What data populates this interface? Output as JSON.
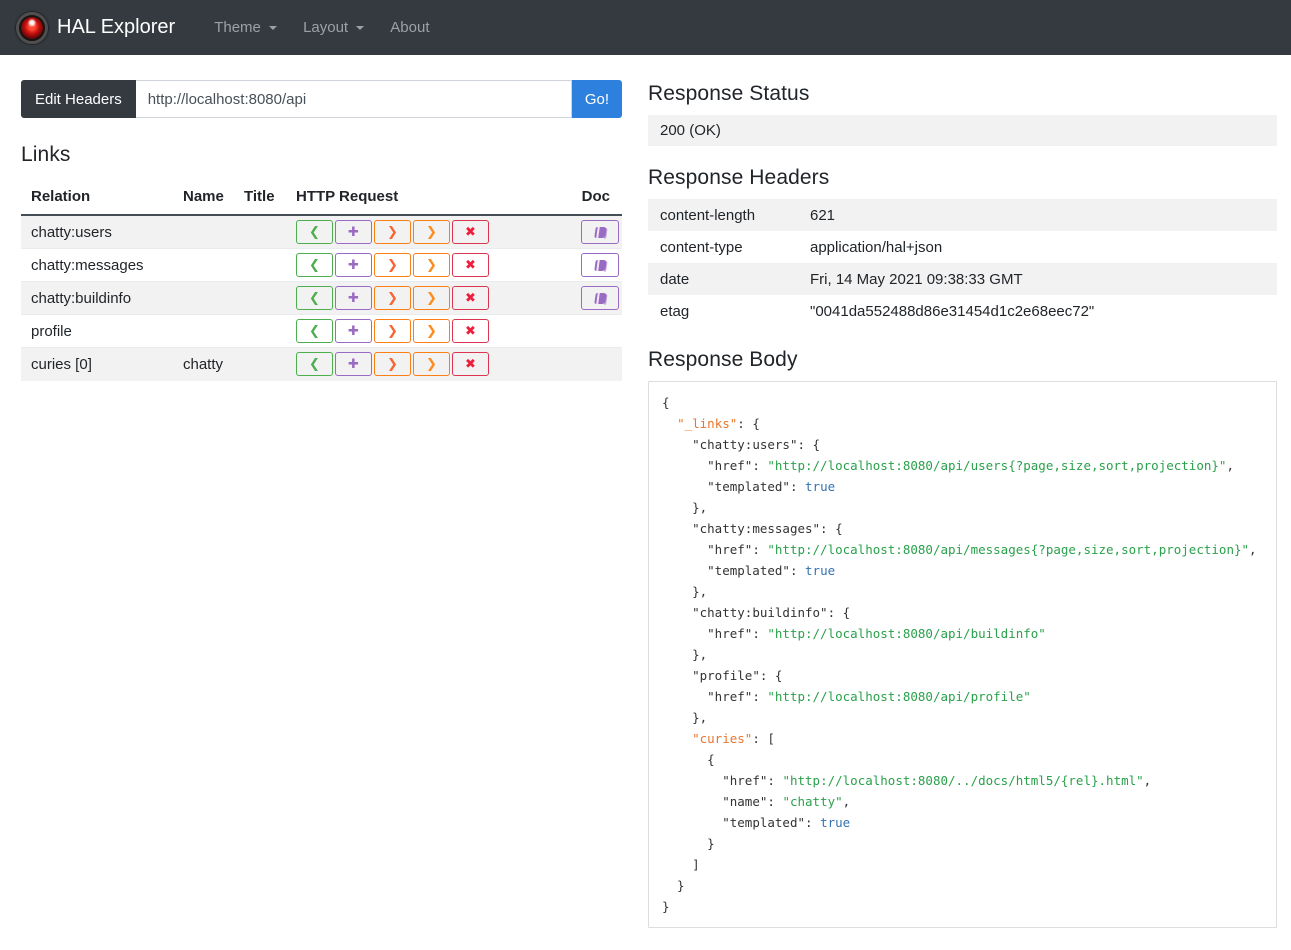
{
  "colors": {
    "navbar_bg": "#343a40",
    "brand_text": "#ffffff",
    "nav_link": "#9ba1a6",
    "primary_button": "#2e80de",
    "dark_button": "#343a40",
    "heading_text": "#212529",
    "stripe_bg": "#f2f2f2",
    "doc_color": "#9b6bc3",
    "json_punct": "#333333",
    "json_key": "#333333",
    "json_okey": "#e8762d",
    "json_string": "#2aa14b",
    "json_literal": "#3572b0"
  },
  "navbar": {
    "brand": "HAL Explorer",
    "logo": "hal-9000-eye",
    "menu": [
      {
        "id": "theme",
        "label": "Theme",
        "caret": true
      },
      {
        "id": "layout",
        "label": "Layout",
        "caret": true
      },
      {
        "id": "about",
        "label": "About",
        "caret": false
      }
    ]
  },
  "request_bar": {
    "edit_headers_label": "Edit Headers",
    "url_value": "http://localhost:8080/api",
    "go_label": "Go!"
  },
  "links_section": {
    "title": "Links",
    "columns": [
      "Relation",
      "Name",
      "Title",
      "HTTP Request",
      "Doc"
    ],
    "http_buttons": [
      {
        "id": "get",
        "glyph": "❮",
        "border": "#4cae4c",
        "color": "#4cae4c"
      },
      {
        "id": "post",
        "glyph": "✚",
        "border": "#9b6bc3",
        "color": "#9b6bc3"
      },
      {
        "id": "put",
        "glyph": "❯",
        "border": "#fd7e14",
        "color": "#fa6432"
      },
      {
        "id": "patch",
        "glyph": "❯",
        "border": "#fd7e14",
        "color": "#fd8c1e"
      },
      {
        "id": "delete",
        "glyph": "✖",
        "border": "#dc3552",
        "color": "#ef1c3c"
      }
    ],
    "rows": [
      {
        "relation": "chatty:users",
        "name": "",
        "title": "",
        "doc": true
      },
      {
        "relation": "chatty:messages",
        "name": "",
        "title": "",
        "doc": true
      },
      {
        "relation": "chatty:buildinfo",
        "name": "",
        "title": "",
        "doc": true
      },
      {
        "relation": "profile",
        "name": "",
        "title": "",
        "doc": false
      },
      {
        "relation": "curies [0]",
        "name": "chatty",
        "title": "",
        "doc": false
      }
    ]
  },
  "response_status": {
    "title": "Response Status",
    "value": "200 (OK)"
  },
  "response_headers": {
    "title": "Response Headers",
    "rows": [
      {
        "key": "content-length",
        "value": "621"
      },
      {
        "key": "content-type",
        "value": "application/hal+json"
      },
      {
        "key": "date",
        "value": "Fri, 14 May 2021 09:38:33 GMT"
      },
      {
        "key": "etag",
        "value": "\"0041da552488d86e31454d1c2e68eec72\""
      }
    ]
  },
  "response_body": {
    "title": "Response Body",
    "lines": [
      [
        [
          "p",
          "{"
        ]
      ],
      [
        [
          "p",
          "  "
        ],
        [
          "o",
          "\"_links\""
        ],
        [
          "p",
          ": {"
        ]
      ],
      [
        [
          "p",
          "    "
        ],
        [
          "k",
          "\"chatty:users\""
        ],
        [
          "p",
          ": {"
        ]
      ],
      [
        [
          "p",
          "      "
        ],
        [
          "k",
          "\"href\""
        ],
        [
          "p",
          ": "
        ],
        [
          "s",
          "\"http://localhost:8080/api/users{?page,size,sort,projection}\""
        ],
        [
          "p",
          ","
        ]
      ],
      [
        [
          "p",
          "      "
        ],
        [
          "k",
          "\"templated\""
        ],
        [
          "p",
          ": "
        ],
        [
          "l",
          "true"
        ]
      ],
      [
        [
          "p",
          "    },"
        ]
      ],
      [
        [
          "p",
          "    "
        ],
        [
          "k",
          "\"chatty:messages\""
        ],
        [
          "p",
          ": {"
        ]
      ],
      [
        [
          "p",
          "      "
        ],
        [
          "k",
          "\"href\""
        ],
        [
          "p",
          ": "
        ],
        [
          "s",
          "\"http://localhost:8080/api/messages{?page,size,sort,projection}\""
        ],
        [
          "p",
          ","
        ]
      ],
      [
        [
          "p",
          "      "
        ],
        [
          "k",
          "\"templated\""
        ],
        [
          "p",
          ": "
        ],
        [
          "l",
          "true"
        ]
      ],
      [
        [
          "p",
          "    },"
        ]
      ],
      [
        [
          "p",
          "    "
        ],
        [
          "k",
          "\"chatty:buildinfo\""
        ],
        [
          "p",
          ": {"
        ]
      ],
      [
        [
          "p",
          "      "
        ],
        [
          "k",
          "\"href\""
        ],
        [
          "p",
          ": "
        ],
        [
          "s",
          "\"http://localhost:8080/api/buildinfo\""
        ]
      ],
      [
        [
          "p",
          "    },"
        ]
      ],
      [
        [
          "p",
          "    "
        ],
        [
          "k",
          "\"profile\""
        ],
        [
          "p",
          ": {"
        ]
      ],
      [
        [
          "p",
          "      "
        ],
        [
          "k",
          "\"href\""
        ],
        [
          "p",
          ": "
        ],
        [
          "s",
          "\"http://localhost:8080/api/profile\""
        ]
      ],
      [
        [
          "p",
          "    },"
        ]
      ],
      [
        [
          "p",
          "    "
        ],
        [
          "o",
          "\"curies\""
        ],
        [
          "p",
          ": ["
        ]
      ],
      [
        [
          "p",
          "      {"
        ]
      ],
      [
        [
          "p",
          "        "
        ],
        [
          "k",
          "\"href\""
        ],
        [
          "p",
          ": "
        ],
        [
          "s",
          "\"http://localhost:8080/../docs/html5/{rel}.html\""
        ],
        [
          "p",
          ","
        ]
      ],
      [
        [
          "p",
          "        "
        ],
        [
          "k",
          "\"name\""
        ],
        [
          "p",
          ": "
        ],
        [
          "s",
          "\"chatty\""
        ],
        [
          "p",
          ","
        ]
      ],
      [
        [
          "p",
          "        "
        ],
        [
          "k",
          "\"templated\""
        ],
        [
          "p",
          ": "
        ],
        [
          "l",
          "true"
        ]
      ],
      [
        [
          "p",
          "      }"
        ]
      ],
      [
        [
          "p",
          "    ]"
        ]
      ],
      [
        [
          "p",
          "  }"
        ]
      ],
      [
        [
          "p",
          "}"
        ]
      ]
    ]
  }
}
